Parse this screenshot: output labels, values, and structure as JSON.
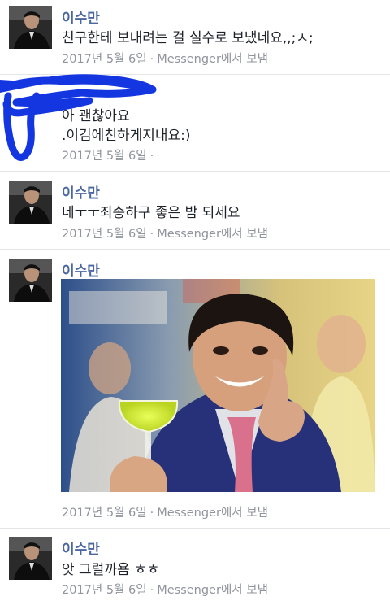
{
  "messages": [
    {
      "sender": "이수만",
      "lines": [
        "친구한테 보내려는 걸 실수로 보냈네요,,;ㅅ;"
      ],
      "date": "2017년 5월 6일",
      "source": "Messenger에서 보냄"
    },
    {
      "sender": "",
      "lines": [
        "아 괜찮아요",
        ".이김에친하게지내요:)"
      ],
      "date": "2017년 5월 6일",
      "source": ""
    },
    {
      "sender": "이수만",
      "lines": [
        "네ㅜㅜ죄송하구 좋은 밤 되세요"
      ],
      "date": "2017년 5월 6일",
      "source": "Messenger에서 보냄"
    },
    {
      "sender": "이수만",
      "lines": [],
      "date": "2017년 5월 6일",
      "source": "Messenger에서 보냄"
    },
    {
      "sender": "이수만",
      "lines": [
        "앗 그럴까욤 ㅎㅎ"
      ],
      "date": "2017년 5월 6일",
      "source": "Messenger에서 보냄"
    }
  ],
  "meta_separator": "·",
  "colors": {
    "name": "#4b67a1",
    "meta": "#90949c",
    "scribble": "#1436e0"
  }
}
